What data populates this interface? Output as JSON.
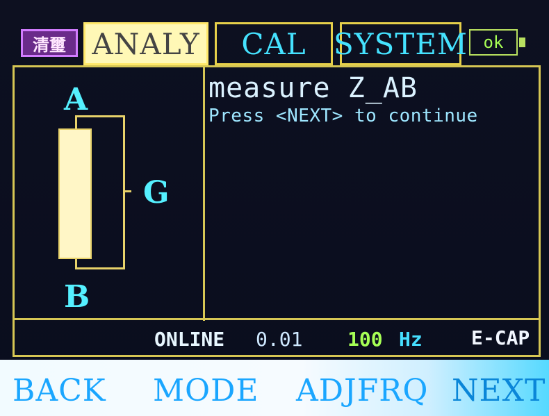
{
  "tabs": {
    "logo": "清璽",
    "analy": "ANALY",
    "cal": "CAL",
    "system": "SYSTEM",
    "status": "ok"
  },
  "diagram": {
    "label_a": "A",
    "label_b": "B",
    "label_g": "G"
  },
  "message": {
    "title": "measure Z_AB",
    "subtitle": "Press <NEXT> to continue"
  },
  "statusline": {
    "online_label": "ONLINE",
    "online_value": "0.01",
    "freq_value": "100",
    "freq_unit": "Hz",
    "mode": "E-CAP"
  },
  "softkeys": {
    "back": "BACK",
    "mode": "MODE",
    "adjfrq": "ADJFRQ",
    "next": "NEXT"
  },
  "colors": {
    "frame": "#d6c654",
    "accent_cyan": "#45e2ff",
    "accent_green": "#a6ff55",
    "softkey_text": "#1aa6ff"
  },
  "icons": {
    "battery": "battery-icon",
    "logo": "brand-logo-icon"
  }
}
